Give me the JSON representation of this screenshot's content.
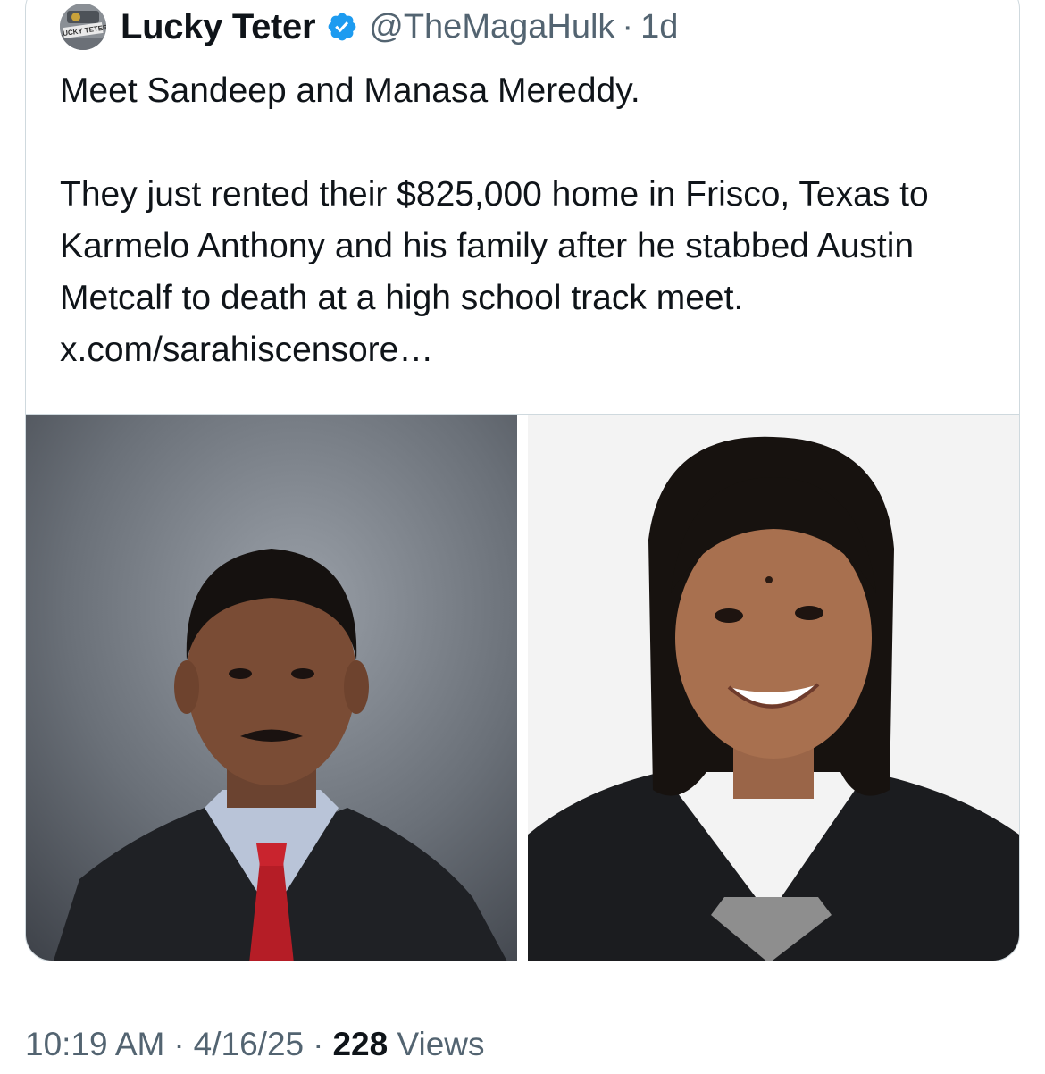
{
  "quoted_tweet": {
    "author_name": "Lucky Teter",
    "handle": "@TheMagaHulk",
    "separator": "·",
    "age": "1d",
    "avatar_text": "LUCKY TETER",
    "paragraphs": [
      "Meet Sandeep and Manasa Mereddy.",
      "They just rented their $825,000 home in Frisco, Texas to Karmelo Anthony and his family after he stabbed Austin Metcalf to death at a high school track meet. x.com/sarahiscensore…"
    ],
    "photos": [
      "man-portrait",
      "woman-portrait"
    ]
  },
  "tweet_meta": {
    "time": "10:19 AM",
    "date": "4/16/25",
    "separator": "·",
    "views_count": "228",
    "views_label": "Views"
  },
  "colors": {
    "text": "#0f1419",
    "secondary": "#536471",
    "verified": "#1d9bf0",
    "border": "#cfd9de"
  }
}
